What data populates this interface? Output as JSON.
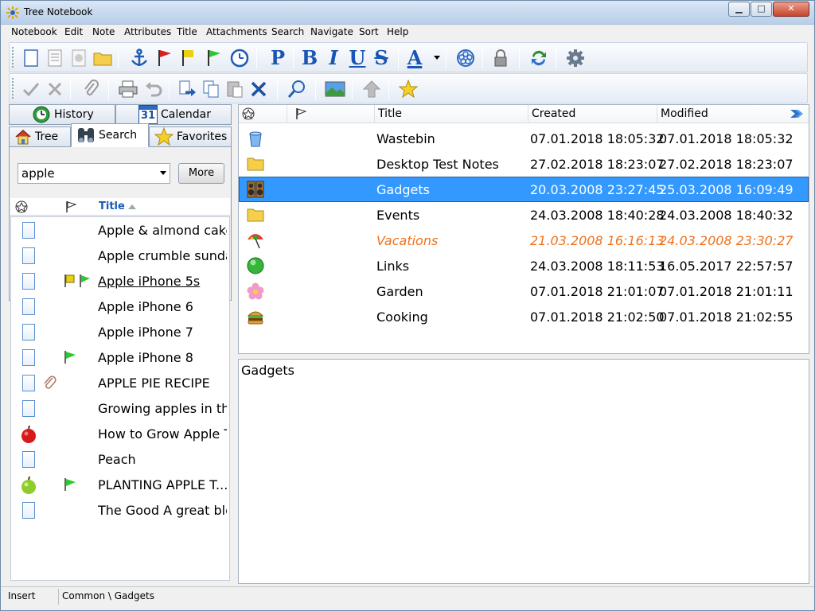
{
  "window": {
    "title": "Tree Notebook",
    "min_label": "▁",
    "max_label": "□",
    "close_label": "✕"
  },
  "menu": [
    "Notebook",
    "Edit",
    "Note",
    "Attributes",
    "Title",
    "Attachments",
    "Search",
    "Navigate",
    "Sort",
    "Help"
  ],
  "format": {
    "paragraph": "P",
    "bold": "B",
    "italic": "I",
    "underline": "U",
    "strike": "S",
    "fontcolor": "A"
  },
  "colors": {
    "selection": "#3399ff",
    "italic_row": "#f0711b",
    "header_title": "#1a5ab8",
    "accent_blue": "#1a55b5"
  },
  "left": {
    "tabs": {
      "history": "History",
      "calendar": "Calendar",
      "calendar_day": "31",
      "tree": "Tree",
      "search": "Search",
      "favorites": "Favorites"
    },
    "search_value": "apple",
    "more_label": "More",
    "column_title": "Title",
    "results": [
      {
        "title": "Apple & almond cake"
      },
      {
        "title": "Apple crumble sundae"
      },
      {
        "title": "Apple iPhone 5s"
      },
      {
        "title": "Apple iPhone 6"
      },
      {
        "title": "Apple iPhone 7"
      },
      {
        "title": "Apple iPhone 8"
      },
      {
        "title": "APPLE PIE RECIPE"
      },
      {
        "title": "Growing apples in the..."
      },
      {
        "title": "How to Grow Apple Tr..."
      },
      {
        "title": "Peach"
      },
      {
        "title": "PLANTING APPLE T..."
      },
      {
        "title": "The Good A great ble..."
      }
    ]
  },
  "right": {
    "columns": {
      "title": "Title",
      "created": "Created",
      "modified": "Modified"
    },
    "rows": [
      {
        "title": "Wastebin",
        "created": "07.01.2018 18:05:32",
        "modified": "07.01.2018 18:05:32"
      },
      {
        "title": "Desktop Test Notes",
        "created": "27.02.2018 18:23:07",
        "modified": "27.02.2018 18:23:07"
      },
      {
        "title": "Gadgets",
        "created": "20.03.2008 23:27:45",
        "modified": "25.03.2008 16:09:49"
      },
      {
        "title": "Events",
        "created": "24.03.2008 18:40:28",
        "modified": "24.03.2008 18:40:32"
      },
      {
        "title": "Vacations",
        "created": "21.03.2008 16:16:13",
        "modified": "24.03.2008 23:30:27"
      },
      {
        "title": "Links",
        "created": "24.03.2008 18:11:53",
        "modified": "16.05.2017 22:57:57"
      },
      {
        "title": "Garden",
        "created": "07.01.2018 21:01:07",
        "modified": "07.01.2018 21:01:11"
      },
      {
        "title": "Cooking",
        "created": "07.01.2018 21:02:50",
        "modified": "07.01.2018 21:02:55"
      }
    ],
    "editor_text": "Gadgets"
  },
  "status": {
    "mode": "Insert",
    "path": "Common \\ Gadgets"
  }
}
